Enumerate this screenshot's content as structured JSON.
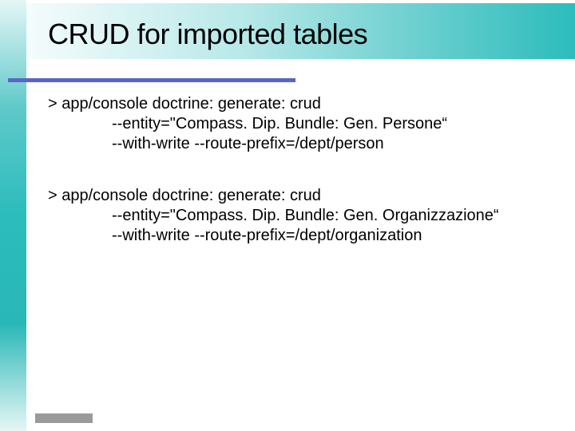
{
  "title": "CRUD for imported tables",
  "blocks": [
    {
      "cmd": "> app/console doctrine: generate: crud",
      "line1": "--entity=\"Compass. Dip. Bundle: Gen. Persone“",
      "line2": "--with-write --route-prefix=/dept/person"
    },
    {
      "cmd": "> app/console doctrine: generate: crud",
      "line1": "--entity=\"Compass. Dip. Bundle: Gen. Organizzazione“",
      "line2": "--with-write --route-prefix=/dept/organization"
    }
  ]
}
